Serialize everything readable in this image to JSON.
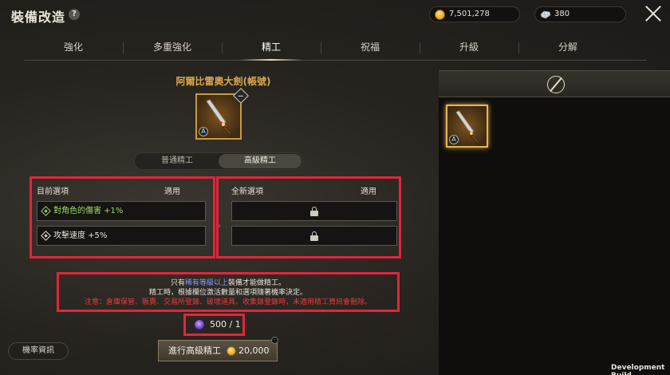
{
  "header": {
    "title": "裝備改造",
    "help_symbol": "?",
    "gold": "7,501,278",
    "crystals": "380"
  },
  "tabs": [
    {
      "label": "強化"
    },
    {
      "label": "多重強化"
    },
    {
      "label": "精工",
      "active": true
    },
    {
      "label": "祝福"
    },
    {
      "label": "升級"
    },
    {
      "label": "分解"
    }
  ],
  "item": {
    "name": "阿爾比雷奧大劍(帳號)",
    "grade": "A"
  },
  "refine_mode": {
    "normal": "普通精工",
    "advanced": "高級精工",
    "selected": "advanced"
  },
  "current_options": {
    "header_left": "目前選項",
    "header_right": "適用",
    "rows": [
      {
        "text": "對角色的傷害 +1%"
      },
      {
        "text": "攻擊速度 +5%"
      }
    ]
  },
  "new_options": {
    "header_left": "全新選項",
    "header_right": "適用",
    "locked_rows": 2
  },
  "notice": {
    "line1_prefix": "只有",
    "line1_highlight": "稀有等級以上",
    "line1_suffix": "裝備才能做精工。",
    "line2": "精工時，根據欄位激活數量和選項隨著機率決定。",
    "line3": "注意：倉庫保管、販賣、交易所登錄、破壞道具、收集錄登錄時，未適用精工資訊會刪除。"
  },
  "material_cost": "500 / 1",
  "buttons": {
    "probability": "機率資訊",
    "execute": "進行高級精工",
    "execute_cost": "20,000",
    "execute_badge": "-"
  },
  "inventory": {
    "item_grade": "A"
  },
  "footer": {
    "build_label": "Development Build"
  },
  "colors": {
    "highlight_border": "#e0263a",
    "item_name": "#d9a74a",
    "option_green": "#9fd86a",
    "warning_red": "#e53b3b",
    "grade_link_blue": "#7f9fff"
  }
}
